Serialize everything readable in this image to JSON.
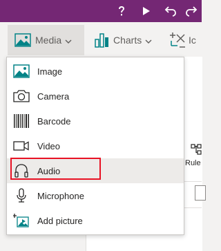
{
  "ribbon": {
    "media_label": "Media",
    "charts_label": "Charts",
    "icons_label": "Ic"
  },
  "dropdown": {
    "items": [
      {
        "label": "Image",
        "icon": "image-icon"
      },
      {
        "label": "Camera",
        "icon": "camera-icon"
      },
      {
        "label": "Barcode",
        "icon": "barcode-icon"
      },
      {
        "label": "Video",
        "icon": "video-icon"
      },
      {
        "label": "Audio",
        "icon": "headphones-icon"
      },
      {
        "label": "Microphone",
        "icon": "microphone-icon"
      },
      {
        "label": "Add picture",
        "icon": "add-picture-icon"
      }
    ],
    "highlighted": "Audio"
  },
  "side_panel": {
    "rules_label": "Rule"
  },
  "colors": {
    "topbar": "#742774",
    "highlight_border": "#e81123",
    "icon_teal": "#038387"
  }
}
